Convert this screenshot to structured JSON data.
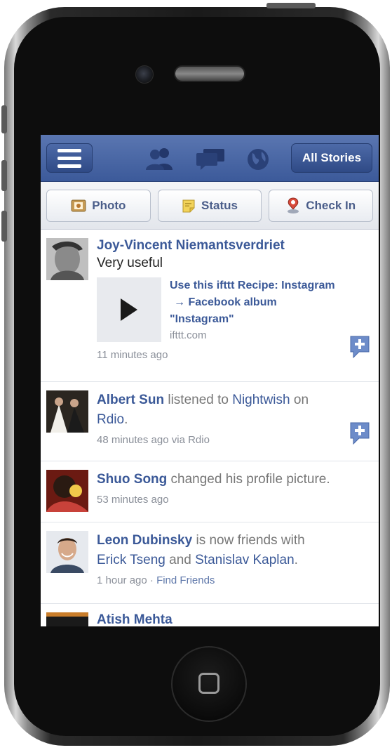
{
  "navbar": {
    "all_stories_label": "All Stories",
    "icons": [
      "menu-icon",
      "friends-icon",
      "messages-icon",
      "globe-icon"
    ]
  },
  "actions": {
    "photo": "Photo",
    "status": "Status",
    "checkin": "Check In"
  },
  "stories": [
    {
      "name": "Joy-Vincent Niemantsverdriet",
      "text": "Very useful",
      "attachment_title_1": "Use this ifttt Recipe: Instagram",
      "attachment_title_2": "→ Facebook album",
      "attachment_title_3": "\"Instagram\"",
      "attachment_domain": "ifttt.com",
      "time": "11 minutes ago"
    },
    {
      "name": "Albert Sun",
      "action": " listened to ",
      "target": "Nightwish",
      "on": " on",
      "app": "Rdio",
      "period": ".",
      "time": "48 minutes ago via Rdio"
    },
    {
      "name": "Shuo Song",
      "action": " changed his profile picture.",
      "time": "53 minutes ago"
    },
    {
      "name": "Leon Dubinsky",
      "action": " is now friends with",
      "friend1": "Erick Tseng",
      "and": " and ",
      "friend2": "Stanislav Kaplan",
      "period": ".",
      "time": "1 hour ago · ",
      "find_friends": "Find Friends"
    },
    {
      "name": "Atish Mehta"
    }
  ],
  "colors": {
    "navbar": "#3c5a9a",
    "link": "#3b5998",
    "meta": "#8a8f99"
  }
}
